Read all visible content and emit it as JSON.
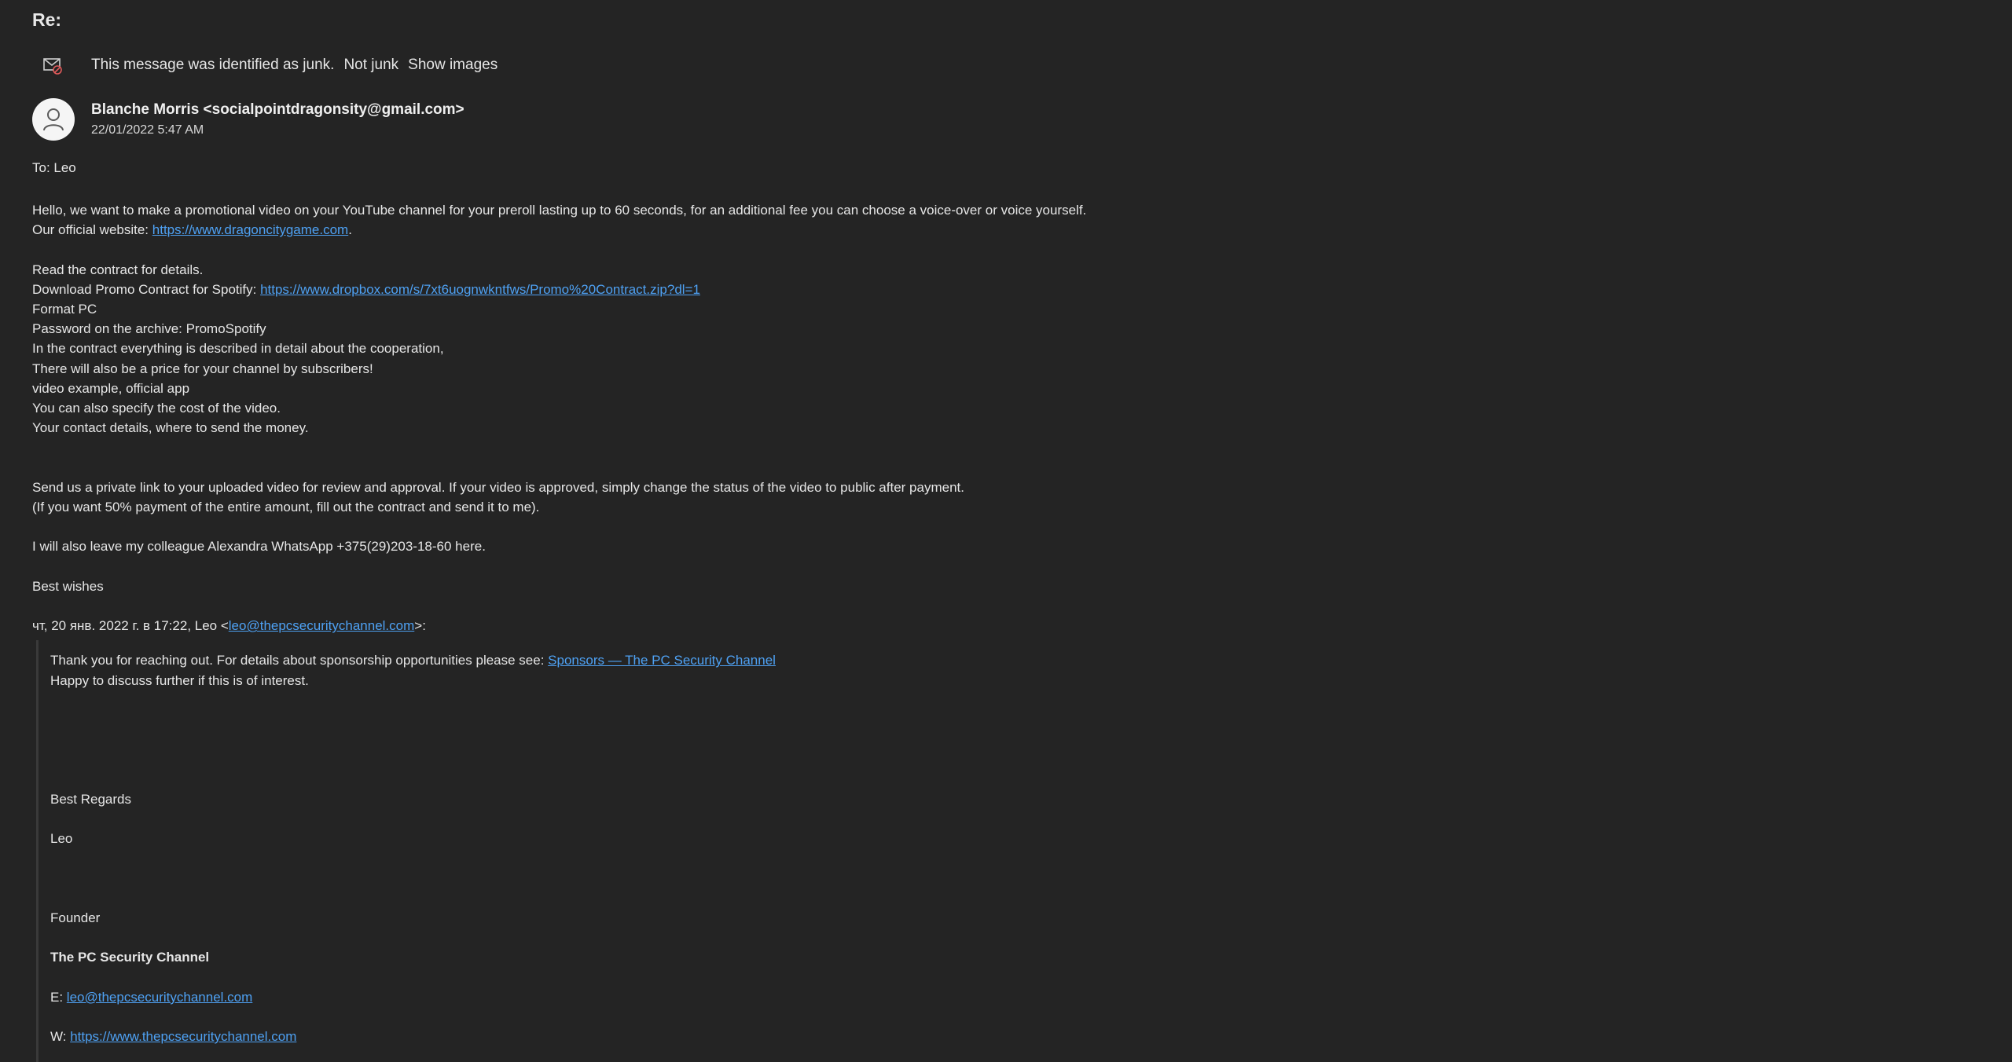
{
  "subject": "Re:",
  "junk_bar": {
    "icon": "junk-mail-icon",
    "message": "This message was identified as junk.",
    "not_junk": "Not junk",
    "show_images": "Show images"
  },
  "sender": {
    "avatar_icon": "person-icon",
    "name_email": "Blanche Morris <socialpointdragonsity@gmail.com>",
    "date": "22/01/2022 5:47 AM"
  },
  "to_line": "To: Leo",
  "body": {
    "p1_text": "Hello, we want to make a promotional video on your YouTube channel for your preroll lasting up to 60 seconds, for an additional fee you can choose a voice-over or voice yourself.",
    "website_prefix": "Our official website: ",
    "website_link": "https://www.dragoncitygame.com",
    "website_suffix": ".",
    "read_contract": "Read the contract for details.",
    "download_prefix": "Download Promo Contract for Spotify: ",
    "download_link": "https://www.dropbox.com/s/7xt6uognwkntfws/Promo%20Contract.zip?dl=1",
    "format": "Format PC",
    "password": "Password on the archive: PromoSpotify",
    "contract_line": "In the contract everything is described in detail about the cooperation,",
    "price_line": "There will also be a price for your channel by subscribers!",
    "video_example": "video example, official app",
    "cost_line": "You can also specify the cost of the video.",
    "contact_line": "Your contact details, where to send the money.",
    "send_link_line": "Send us a private link to your uploaded video for review and approval. If your video is approved, simply change the status of the video to public after payment.",
    "payment_line": "(If you want 50% payment of the entire amount, fill out the contract and send it to me).",
    "colleague_line": "I will also leave my colleague Alexandra WhatsApp +375(29)203-18-60 here.",
    "best_wishes": "Best wishes",
    "quote_header_prefix": "чт, 20 янв. 2022 г. в 17:22, Leo <",
    "quote_header_link": "leo@thepcsecuritychannel.com",
    "quote_header_suffix": ">:"
  },
  "quote": {
    "thanks_prefix": "Thank you for reaching out. For details about sponsorship opportunities please see: ",
    "sponsors_link": "Sponsors — The PC Security Channel",
    "happy_line": "Happy to discuss further if this is of interest.",
    "best_regards": "Best Regards",
    "name": "Leo",
    "title": "Founder",
    "company": "The PC Security Channel",
    "email_prefix": "E: ",
    "email_link": "leo@thepcsecuritychannel.com",
    "web_prefix": "W: ",
    "web_link": "https://www.thepcsecuritychannel.com"
  },
  "colors": {
    "background": "#242424",
    "text": "#e6e6e6",
    "link": "#4ea1f3"
  }
}
